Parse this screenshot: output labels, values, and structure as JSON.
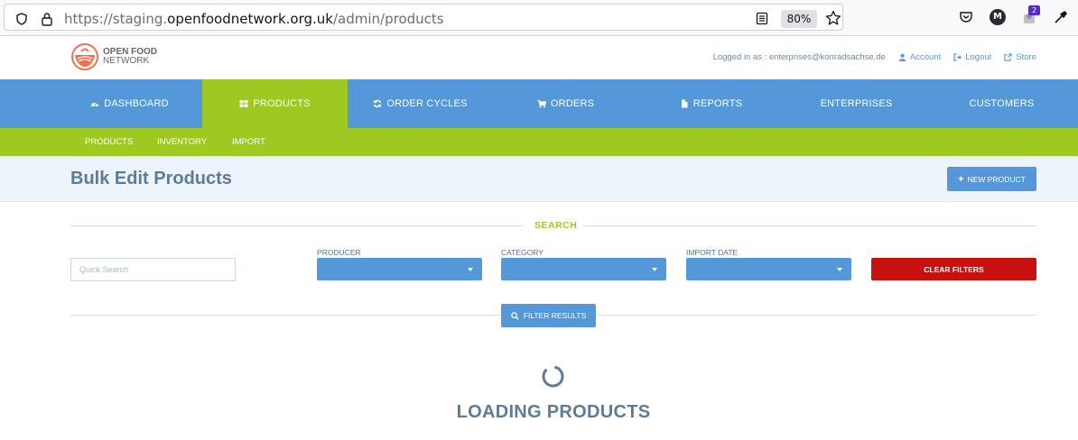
{
  "browser": {
    "url_prefix": "https://staging.",
    "url_domain": "openfoodnetwork.org.uk",
    "url_path": "/admin/products",
    "zoom": "80%",
    "notification_count": "2",
    "profile_initial": "M"
  },
  "header": {
    "logo_line1": "OPEN FOOD",
    "logo_line2": "NETWORK",
    "logged_in_as": "Logged in as : enterprises@konradsachse.de",
    "account_label": "Account",
    "logout_label": "Logout",
    "store_label": "Store"
  },
  "nav": {
    "items": [
      {
        "label": "DASHBOARD",
        "icon": "dashboard-icon"
      },
      {
        "label": "PRODUCTS",
        "icon": "grid-icon"
      },
      {
        "label": "ORDER CYCLES",
        "icon": "refresh-icon"
      },
      {
        "label": "ORDERS",
        "icon": "cart-icon"
      },
      {
        "label": "REPORTS",
        "icon": "file-icon"
      },
      {
        "label": "ENTERPRISES",
        "icon": ""
      },
      {
        "label": "CUSTOMERS",
        "icon": ""
      }
    ],
    "active_index": 1
  },
  "subnav": {
    "items": [
      "PRODUCTS",
      "INVENTORY",
      "IMPORT"
    ]
  },
  "page": {
    "title": "Bulk Edit Products",
    "new_product_label": "NEW PRODUCT"
  },
  "search": {
    "section_label": "SEARCH",
    "quick_search_placeholder": "Quick Search",
    "producer_label": "PRODUCER",
    "category_label": "CATEGORY",
    "import_date_label": "IMPORT DATE",
    "clear_filters_label": "CLEAR FILTERS",
    "filter_results_label": "FILTER RESULTS"
  },
  "loading_text": "LOADING PRODUCTS",
  "colors": {
    "nav_blue": "#5498da",
    "active_green": "#9fc820",
    "danger_red": "#c8100f",
    "title_text": "#5b7c99"
  }
}
